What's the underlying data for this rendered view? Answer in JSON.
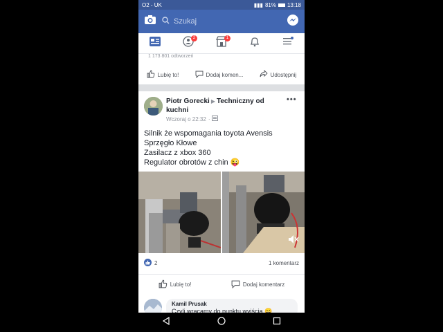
{
  "status_bar": {
    "carrier": "O2 - UK",
    "battery": "81%",
    "time": "13:18"
  },
  "search": {
    "placeholder": "Szukaj"
  },
  "nav": {
    "items": [
      {
        "icon": "news-feed-icon"
      },
      {
        "icon": "friends-icon",
        "badge": "2"
      },
      {
        "icon": "marketplace-icon",
        "badge": "1"
      },
      {
        "icon": "notifications-icon"
      },
      {
        "icon": "menu-icon"
      }
    ]
  },
  "previous_post": {
    "views": "1 173 801 odtworzeń",
    "actions": {
      "like": "Lubię to!",
      "comment": "Dodaj komen...",
      "share": "Udostępnij"
    }
  },
  "post": {
    "author": "Piotr Gorecki",
    "group": "Techniczny od kuchni",
    "timestamp": "Wczoraj o 22:32",
    "text_lines": [
      "Silnik że wspomagania toyota Avensis",
      "Sprzęgło Kłowe",
      "Zasilacz z xbox 360",
      "Regulator obrotów z chin 😜"
    ],
    "reaction_count": "2",
    "comment_count": "1 komentarz",
    "actions": {
      "like": "Lubię to!",
      "comment": "Dodaj komentarz"
    }
  },
  "comment": {
    "author": "Kamil Prusak",
    "text": "Czyli wracamy do punktu wyjścia 😀"
  },
  "colors": {
    "brand": "#4267b2",
    "status": "#3b5998",
    "badge": "#fa3e3e"
  }
}
